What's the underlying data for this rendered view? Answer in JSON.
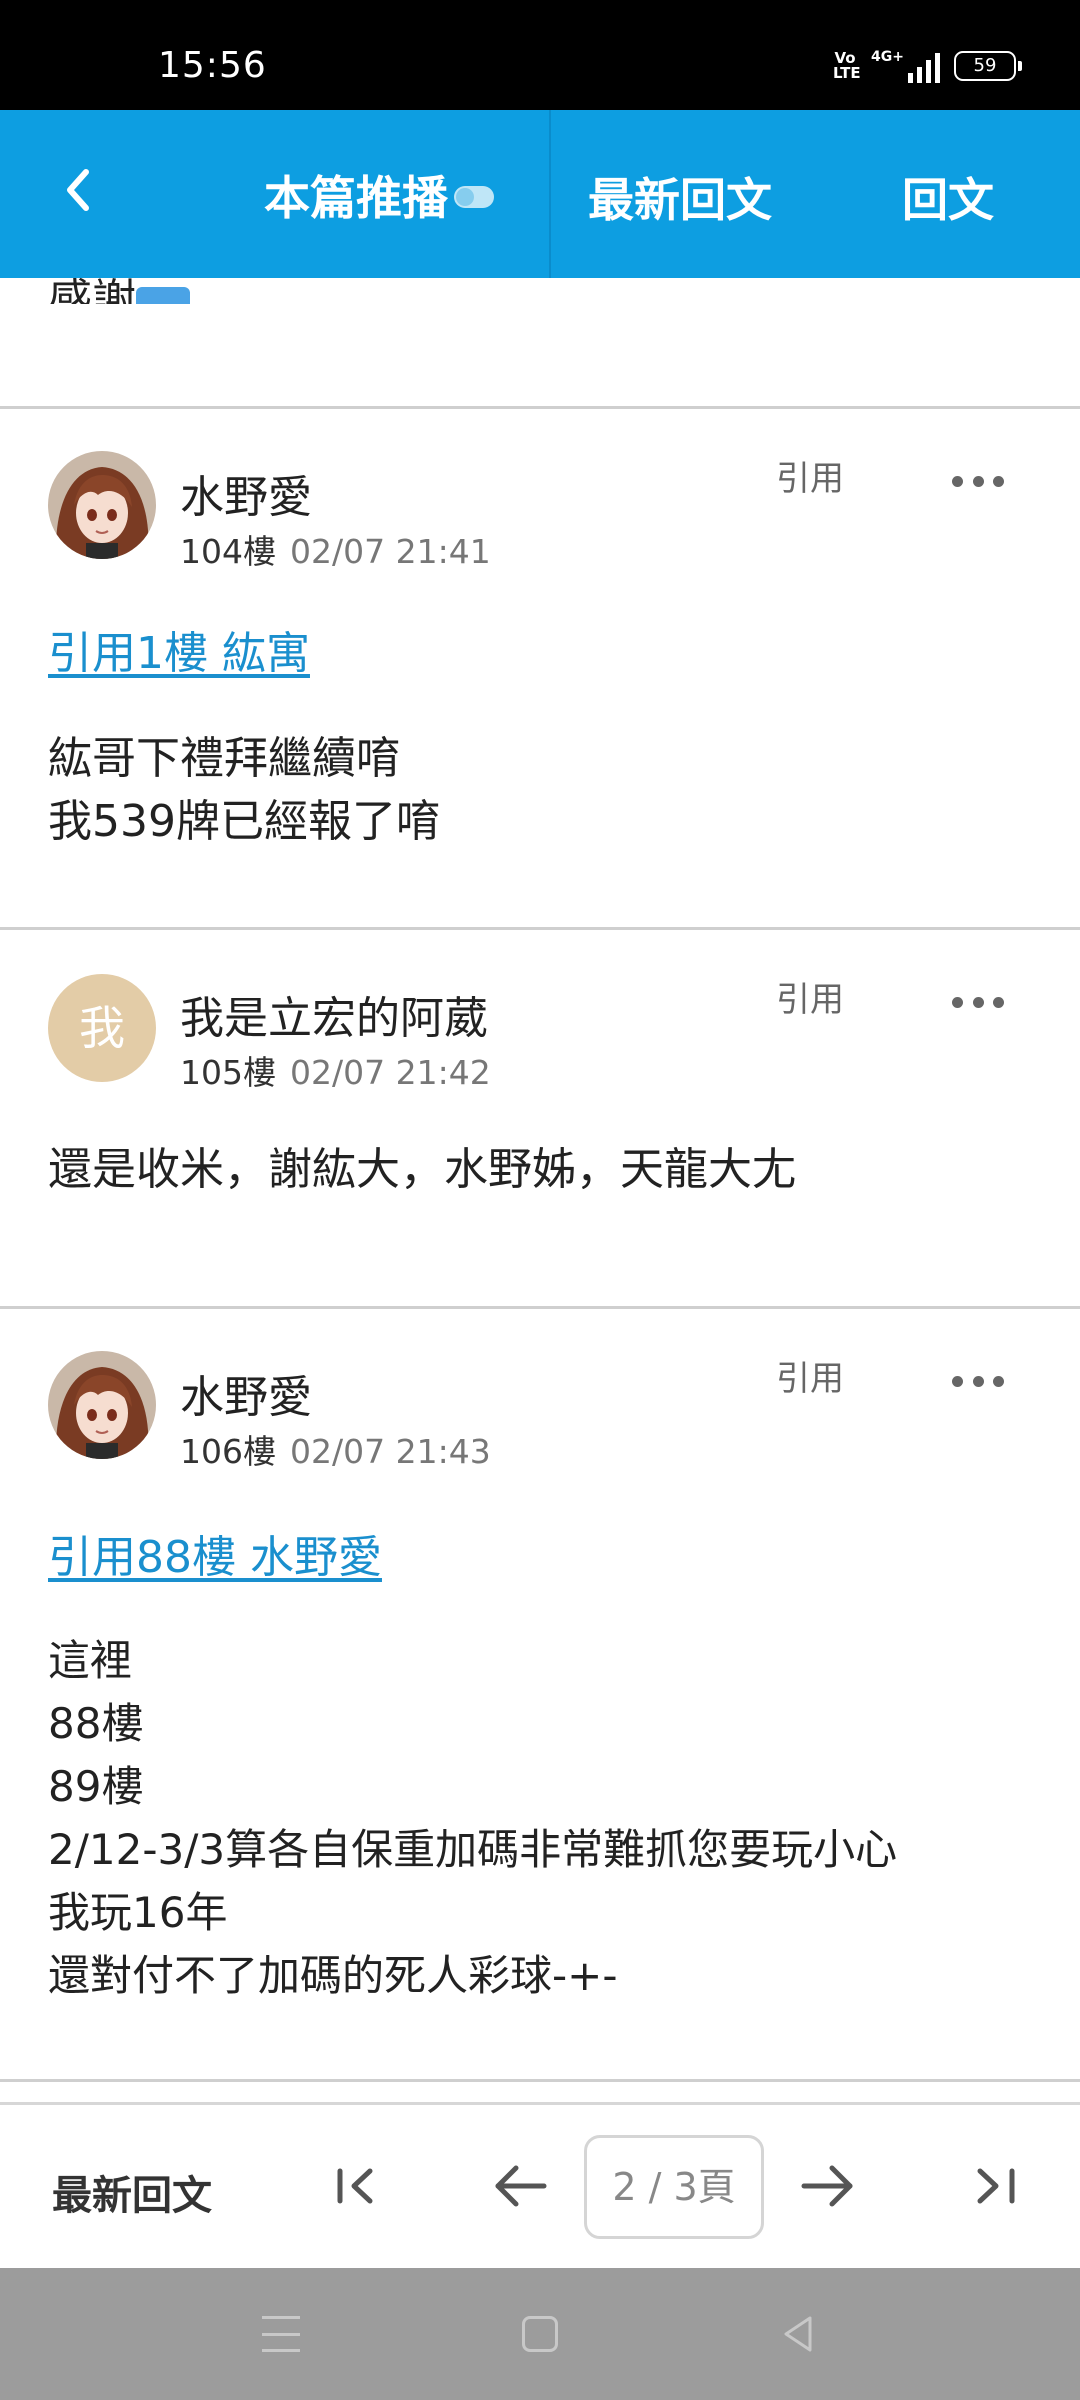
{
  "status_bar": {
    "time": "15:56",
    "volte": "Vo LTE",
    "network": "4G+",
    "battery": "59"
  },
  "header": {
    "back_icon": "‹",
    "recommend_label": "本篇推播",
    "latest_reply": "最新回文",
    "reply": "回文"
  },
  "top_remnant": "感謝",
  "posts": [
    {
      "author": "水野愛",
      "floor": "104樓",
      "time": "02/07 21:41",
      "quote_btn": "引用",
      "quote_link": "引用1樓 紘寓",
      "lines": [
        "紘哥下禮拜繼續唷",
        "我539牌已經報了唷"
      ]
    },
    {
      "author": "我是立宏的阿葳",
      "avatar_text": "我",
      "floor": "105樓",
      "time": "02/07 21:42",
      "quote_btn": "引用",
      "lines": [
        "還是收米，謝紘大，水野姊，天龍大尢"
      ]
    },
    {
      "author": "水野愛",
      "floor": "106樓",
      "time": "02/07 21:43",
      "quote_btn": "引用",
      "quote_link": "引用88樓 水野愛",
      "lines": [
        "這裡",
        "88樓",
        "89樓",
        "2/12-3/3算各自保重加碼非常難抓您要玩小心",
        "我玩16年",
        "還對付不了加碼的死人彩球-+-"
      ]
    }
  ],
  "bottom_nav": {
    "latest_reply": "最新回文",
    "page_indicator": "2 / 3頁",
    "first_icon": "I<",
    "prev_icon": "←",
    "next_icon": "→",
    "last_icon": ">I"
  }
}
